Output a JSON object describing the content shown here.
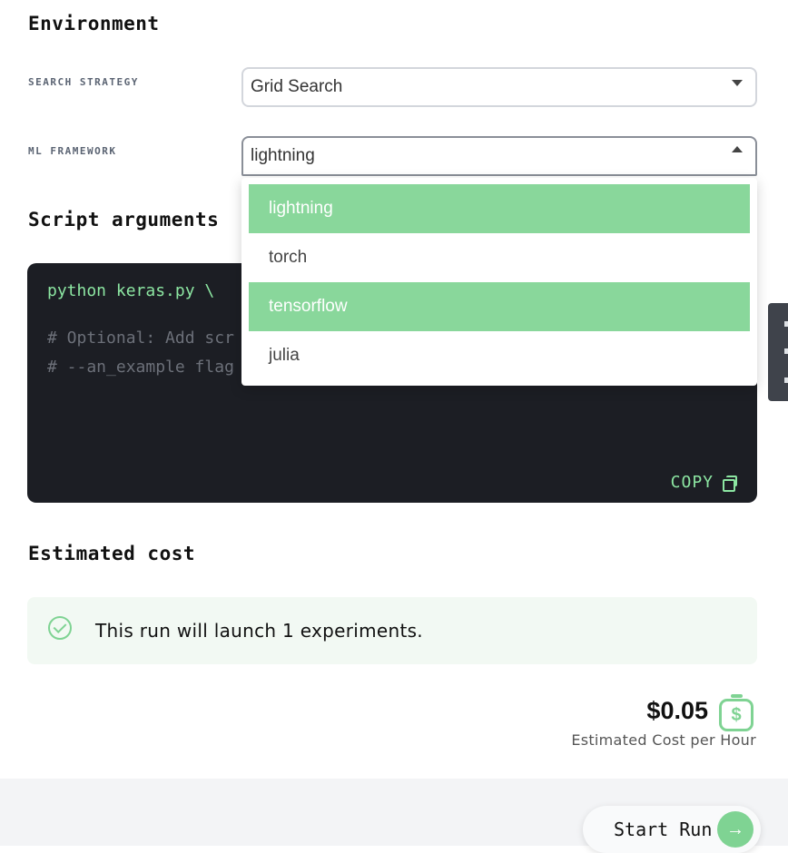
{
  "environment": {
    "heading": "Environment",
    "search_strategy": {
      "label": "SEARCH STRATEGY",
      "value": "Grid Search"
    },
    "ml_framework": {
      "label": "ML FRAMEWORK",
      "value": "lightning",
      "options": [
        {
          "label": "lightning",
          "highlighted": true
        },
        {
          "label": "torch",
          "highlighted": false
        },
        {
          "label": "tensorflow",
          "highlighted": true
        },
        {
          "label": "julia",
          "highlighted": false
        }
      ]
    }
  },
  "script_arguments": {
    "heading": "Script arguments",
    "command": "python keras.py \\",
    "comment_1": "# Optional: Add scr",
    "comment_2": "# --an_example flag",
    "copy_label": "COPY"
  },
  "estimated_cost": {
    "heading": "Estimated cost",
    "info": "This run will launch 1 experiments.",
    "price": "$0.05",
    "price_label": "Estimated Cost per Hour"
  },
  "footer": {
    "start_label": "Start Run"
  },
  "colors": {
    "accent": "#7fd393",
    "highlight": "#89d79b",
    "code_bg": "#1c1e24"
  },
  "icons": {
    "dropdown": "caret-icon",
    "copy": "copy-icon",
    "check": "check-circle-icon",
    "cost": "dollar-icon",
    "start": "arrow-right-icon"
  }
}
